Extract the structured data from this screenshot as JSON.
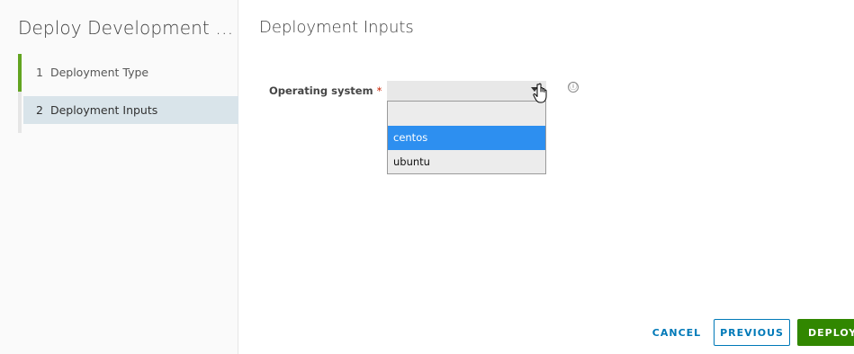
{
  "sidebar": {
    "title": "Deploy Development Te...",
    "steps": [
      {
        "number": "1",
        "label": "Deployment Type"
      },
      {
        "number": "2",
        "label": "Deployment Inputs"
      }
    ]
  },
  "main": {
    "title": "Deployment Inputs",
    "field": {
      "label": "Operating system",
      "required_mark": "*",
      "value": "",
      "options": [
        "",
        "centos",
        "ubuntu"
      ],
      "highlighted_option": "centos"
    },
    "info_icon": "ⓘ"
  },
  "footer": {
    "cancel_label": "CANCEL",
    "previous_label": "PREVIOUS",
    "deploy_label": "DEPLOY"
  },
  "colors": {
    "accent_green": "#62a420",
    "deploy_green": "#318700",
    "link_blue": "#0079b8",
    "option_highlight": "#2d8ff0",
    "active_step_bg": "#d9e4ea"
  }
}
